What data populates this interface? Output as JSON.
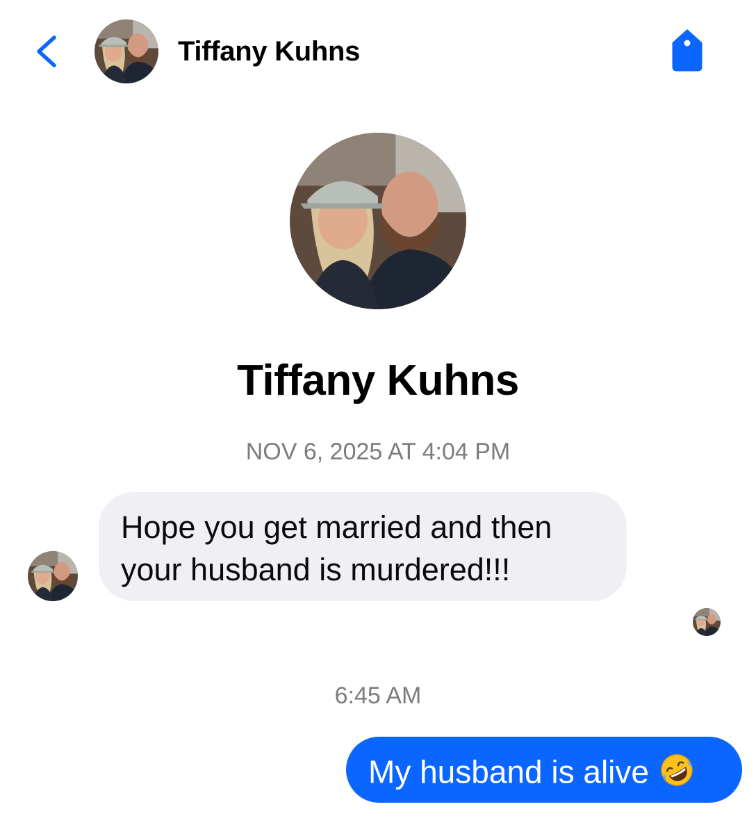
{
  "header": {
    "back_icon": "chevron-left-icon",
    "contact_name": "Tiffany Kuhns",
    "tag_icon": "tag-icon"
  },
  "profile": {
    "name": "Tiffany Kuhns"
  },
  "conversation": {
    "timestamp_1": "NOV 6, 2025 AT 4:04 PM",
    "incoming_message": "Hope you get married and then your husband is murdered!!!",
    "timestamp_2": "6:45 AM",
    "outgoing_message": "My husband is alive",
    "outgoing_emoji": "rolling-on-floor-laughing-emoji"
  },
  "colors": {
    "accent": "#0a66ff",
    "incoming_bubble": "#f0f0f4",
    "timestamp": "#7b7b80"
  }
}
